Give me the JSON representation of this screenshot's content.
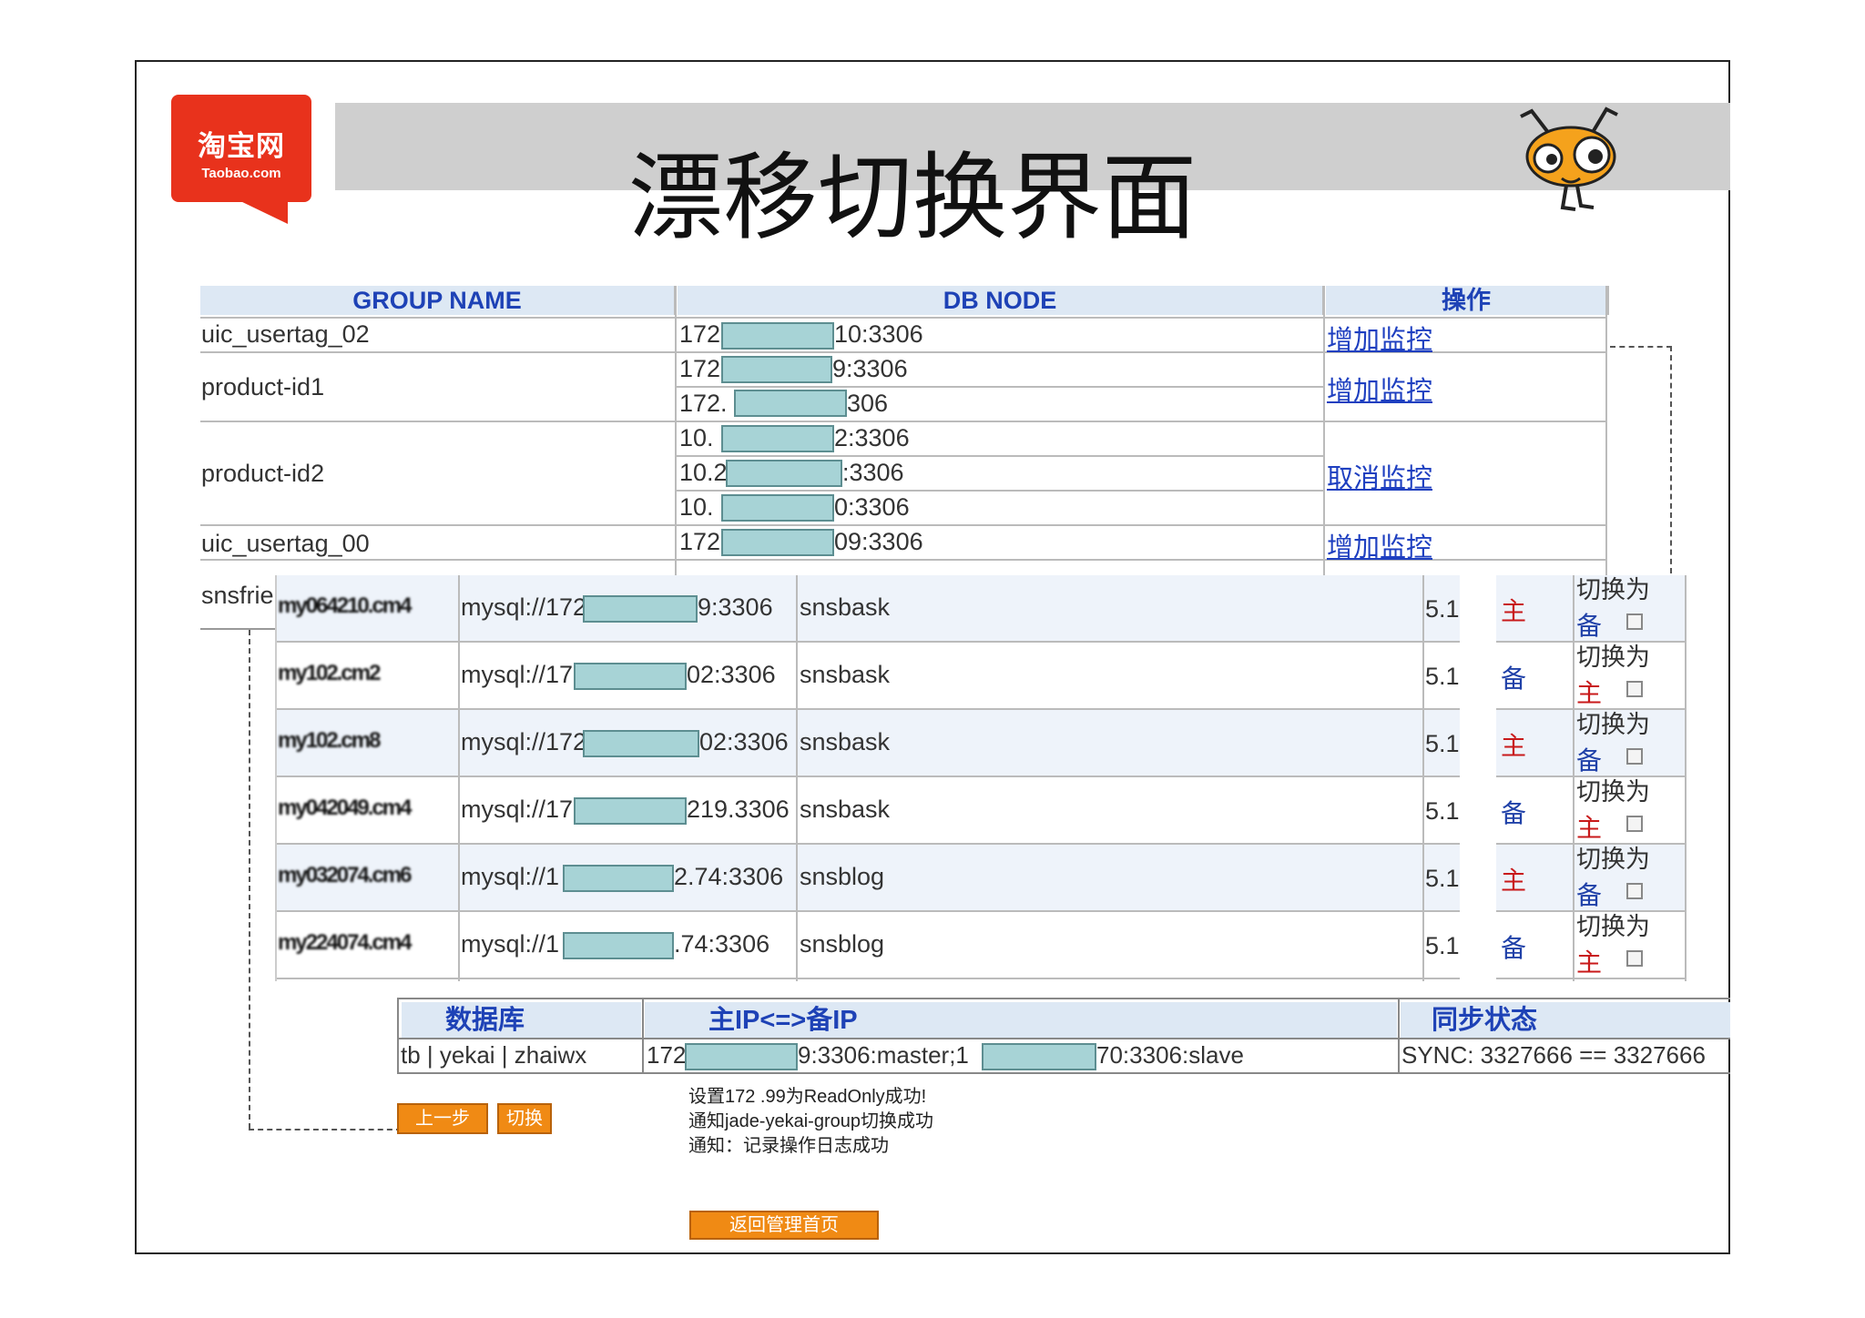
{
  "slide": {
    "title": "漂移切换界面",
    "logo_cn": "淘宝网",
    "logo_en": "Taobao.com"
  },
  "table1": {
    "headers": [
      "GROUP NAME",
      "DB NODE",
      "操作"
    ],
    "groups": [
      "uic_usertag_02",
      "product-id1",
      "product-id2",
      "uic_usertag_00",
      "snsfrie"
    ],
    "nodes": [
      {
        "pre": "172",
        "post": "10:3306"
      },
      {
        "pre": "172",
        "post": "9:3306"
      },
      {
        "pre": "172.",
        "post": "306"
      },
      {
        "pre": "10.",
        "post": "2:3306"
      },
      {
        "pre": "10.2",
        "post": ":3306"
      },
      {
        "pre": "10.",
        "post": "0:3306"
      },
      {
        "pre": "172",
        "post": "09:3306"
      }
    ],
    "actions": [
      "增加监控",
      "增加监控",
      "取消监控",
      "增加监控"
    ]
  },
  "table2": {
    "rows": [
      {
        "host": "my064210.cm4",
        "url_pre": "mysql://172",
        "url_post": "9:3306",
        "db": "snsbask",
        "ver": "5.1",
        "role": "主",
        "switch_label": "切换为",
        "switch_to": "备"
      },
      {
        "host": "my102.cm2",
        "url_pre": "mysql://17",
        "url_post": "02:3306",
        "db": "snsbask",
        "ver": "5.1",
        "role": "备",
        "switch_label": "切换为",
        "switch_to": "主"
      },
      {
        "host": "my102.cm8",
        "url_pre": "mysql://172",
        "url_post": "02:3306",
        "db": "snsbask",
        "ver": "5.1",
        "role": "主",
        "switch_label": "切换为",
        "switch_to": "备"
      },
      {
        "host": "my042049.cm4",
        "url_pre": "mysql://17",
        "url_post": "219.3306",
        "db": "snsbask",
        "ver": "5.1",
        "role": "备",
        "switch_label": "切换为",
        "switch_to": "主"
      },
      {
        "host": "my032074.cm6",
        "url_pre": "mysql://1",
        "url_post": "2.74:3306",
        "db": "snsblog",
        "ver": "5.1",
        "role": "主",
        "switch_label": "切换为",
        "switch_to": "备"
      },
      {
        "host": "my224074.cm4",
        "url_pre": "mysql://1",
        "url_post": ".74:3306",
        "db": "snsblog",
        "ver": "5.1",
        "role": "备",
        "switch_label": "切换为",
        "switch_to": "主"
      }
    ]
  },
  "table3": {
    "headers": [
      "数据库",
      "主IP<=>备IP",
      "同步状态"
    ],
    "row": {
      "db": "tb | yekai | zhaiwx",
      "ip_pre": "172",
      "ip_mid": "9:3306:master;1",
      "ip_post": "70:3306:slave",
      "sync": "SYNC: 3327666 == 3327666"
    }
  },
  "buttons": {
    "prev": "上一步",
    "switch": "切换",
    "back": "返回管理首页"
  },
  "notes": [
    "设置172            .99为ReadOnly成功!",
    "通知jade-yekai-group切换成功",
    "通知：记录操作日志成功"
  ],
  "colors": {
    "brand_red": "#e8321c",
    "header_blue": "#1e42b6",
    "mask_teal": "#a7d3d6",
    "button_orange": "#f08a14"
  }
}
